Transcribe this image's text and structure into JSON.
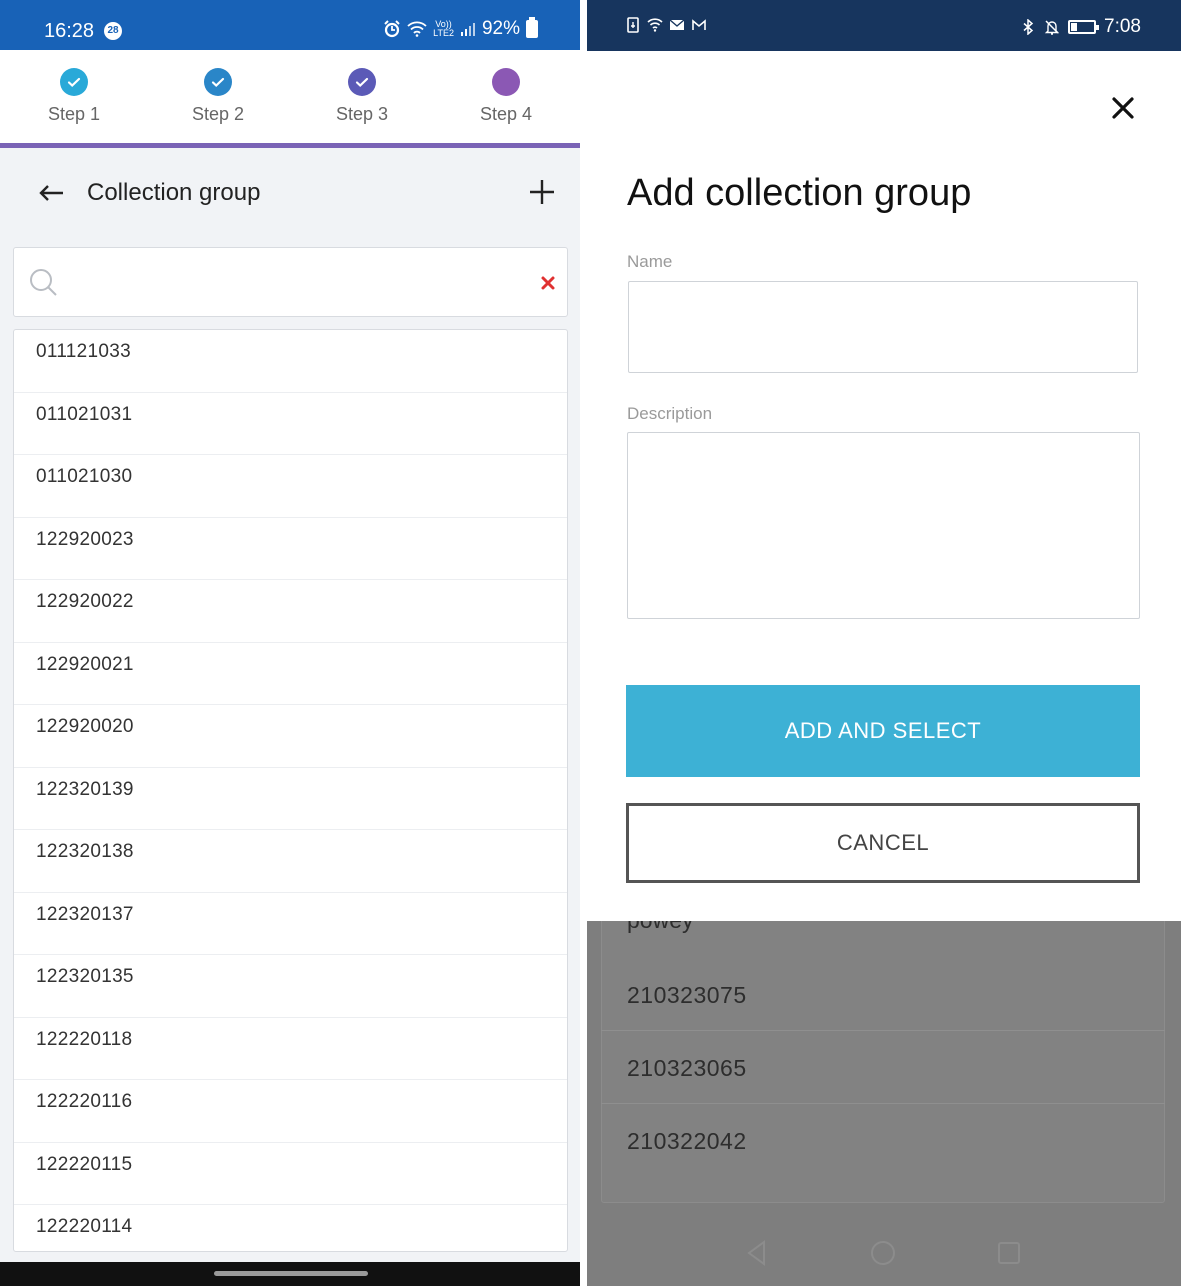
{
  "left_screen": {
    "status_bar": {
      "time": "16:28",
      "notification_count": "28",
      "volte": "Vo))",
      "lte": "LTE2",
      "battery": "92%"
    },
    "stepper": {
      "steps": [
        {
          "label": "Step 1",
          "state": "complete",
          "color": "#29a9d8"
        },
        {
          "label": "Step 2",
          "state": "complete",
          "color": "#2a86c8"
        },
        {
          "label": "Step 3",
          "state": "complete",
          "color": "#5b5ab7"
        },
        {
          "label": "Step 4",
          "state": "current",
          "color": "#8b58b4"
        }
      ],
      "accent_line_color": "#7a63b6"
    },
    "header": {
      "title": "Collection group",
      "back_icon": "arrow-left-icon",
      "add_icon": "plus-icon"
    },
    "search": {
      "value": "",
      "placeholder": "",
      "search_icon": "search-icon",
      "clear_icon": "close-icon",
      "clear_color": "#e03131"
    },
    "list": {
      "items": [
        "011121033",
        "011021031",
        "011021030",
        "122920023",
        "122920022",
        "122920021",
        "122920020",
        "122320139",
        "122320138",
        "122320137",
        "122320135",
        "122220118",
        "122220116",
        "122220115",
        "122220114"
      ]
    }
  },
  "right_screen": {
    "status_bar": {
      "time": "7:08"
    },
    "dialog": {
      "title": "Add collection group",
      "name_label": "Name",
      "name_value": "",
      "description_label": "Description",
      "description_value": "",
      "primary_button": "ADD AND SELECT",
      "secondary_button": "CANCEL",
      "close_icon": "close-icon",
      "primary_color": "#3db1d5"
    },
    "background_list": {
      "partial_item": "powey",
      "items": [
        "210323075",
        "210323065",
        "210322042"
      ]
    },
    "nav_bar": {
      "icons": [
        "back-triangle-icon",
        "home-circle-icon",
        "recents-square-icon"
      ]
    }
  }
}
